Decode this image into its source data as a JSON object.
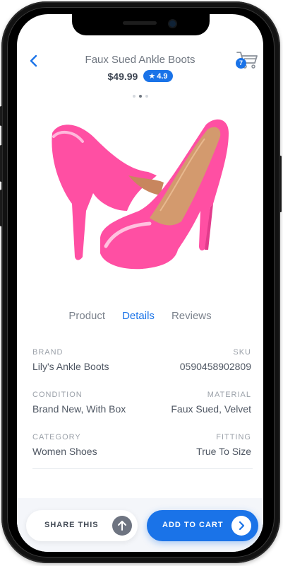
{
  "product": {
    "title": "Faux Sued Ankle Boots",
    "price": "$49.99",
    "rating": "4.9",
    "rating_icon": "star-icon"
  },
  "header": {
    "back_icon": "chevron-left-icon",
    "cart_icon": "shopping-cart-icon",
    "cart_count": "7"
  },
  "gallery": {
    "image": "pink-high-heel-shoes",
    "dots_total": 3,
    "active_dot": 2
  },
  "tabs": [
    {
      "label": "Product",
      "active": false
    },
    {
      "label": "Details",
      "active": true
    },
    {
      "label": "Reviews",
      "active": false
    }
  ],
  "details": {
    "brand": {
      "label": "BRAND",
      "value": "Lily's Ankle Boots"
    },
    "sku": {
      "label": "SKU",
      "value": "0590458902809"
    },
    "condition": {
      "label": "CONDITION",
      "value": "Brand New, With Box"
    },
    "material": {
      "label": "MATERIAL",
      "value": "Faux Sued, Velvet"
    },
    "category": {
      "label": "CATEGORY",
      "value": "Women Shoes"
    },
    "fitting": {
      "label": "FITTING",
      "value": "True To Size"
    }
  },
  "actions": {
    "share_label": "SHARE THIS",
    "share_icon": "arrow-up-icon",
    "add_to_cart_label": "ADD TO CART",
    "add_to_cart_icon": "chevron-right-icon"
  },
  "colors": {
    "accent": "#1a73e8",
    "text_dark": "#3b4350",
    "text_muted": "#9ba1a9",
    "product_pink": "#ff4fa3"
  }
}
